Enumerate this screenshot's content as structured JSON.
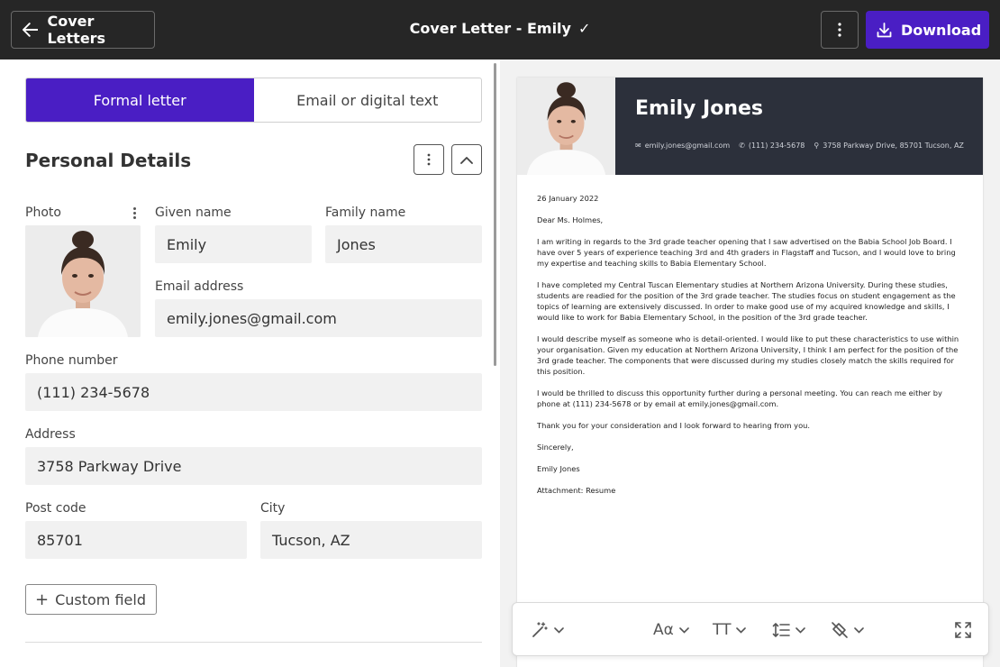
{
  "topbar": {
    "back_label": "Cover Letters",
    "doc_title": "Cover Letter - Emily",
    "download_label": "Download"
  },
  "editor": {
    "tabs": [
      "Formal letter",
      "Email or digital text"
    ],
    "active_tab": "Formal letter",
    "section_title": "Personal Details",
    "fields": {
      "photo_label": "Photo",
      "given_name_label": "Given name",
      "given_name": "Emily",
      "family_name_label": "Family name",
      "family_name": "Jones",
      "email_label": "Email address",
      "email": "emily.jones@gmail.com",
      "phone_label": "Phone number",
      "phone": "(111) 234-5678",
      "address_label": "Address",
      "address": "3758 Parkway Drive",
      "postcode_label": "Post code",
      "postcode": "85701",
      "city_label": "City",
      "city": "Tucson, AZ"
    },
    "custom_field_label": "Custom field"
  },
  "preview": {
    "name": "Emily Jones",
    "email": "emily.jones@gmail.com",
    "phone": "(111) 234-5678",
    "address": "3758 Parkway Drive, 85701 Tucson, AZ",
    "date": "26 January 2022",
    "greeting": "Dear Ms. Holmes,",
    "paragraphs": [
      "I am writing in regards to the 3rd grade teacher opening that I saw advertised on the Babia School Job Board. I have over 5 years of experience teaching 3rd and 4th graders in Flagstaff and Tucson, and I would love to bring my expertise and teaching skills to Babia Elementary School.",
      "I have completed my Central Tuscan Elementary studies at Northern Arizona University. During these studies, students are readied for the position of the 3rd grade teacher. The studies focus on student engagement as the topics of learning are extensively discussed. In order to make good use of my acquired knowledge and skills, I would like to work for  Babia Elementary School, in the position of the 3rd grade teacher.",
      "I would describe myself as someone who is detail-oriented. I would like to put these characteristics to use within your organisation. Given my education at Northern Arizona University, I think I am perfect for the position of the 3rd grade teacher. The components that were discussed during my studies closely match the skills required for this position.",
      "I would be thrilled to discuss this opportunity further during a personal meeting. You can reach me either by phone at (111) 234-5678 or by email at emily.jones@gmail.com.",
      "Thank you for your consideration and I look forward to hearing from you."
    ],
    "closing": "Sincerely,",
    "signature": "Emily Jones",
    "attachment": "Attachment: Resume"
  },
  "colors": {
    "accent": "#4a1ec4",
    "topbar": "#262626",
    "letter_header": "#2c303b"
  },
  "icons": [
    "arrow-left-icon",
    "check-icon",
    "more-vertical-icon",
    "download-icon",
    "chevron-up-icon",
    "plus-icon",
    "magic-wand-icon",
    "font-icon",
    "text-size-icon",
    "line-spacing-icon",
    "color-fill-icon",
    "expand-icon",
    "mail-icon",
    "phone-icon",
    "location-icon"
  ]
}
